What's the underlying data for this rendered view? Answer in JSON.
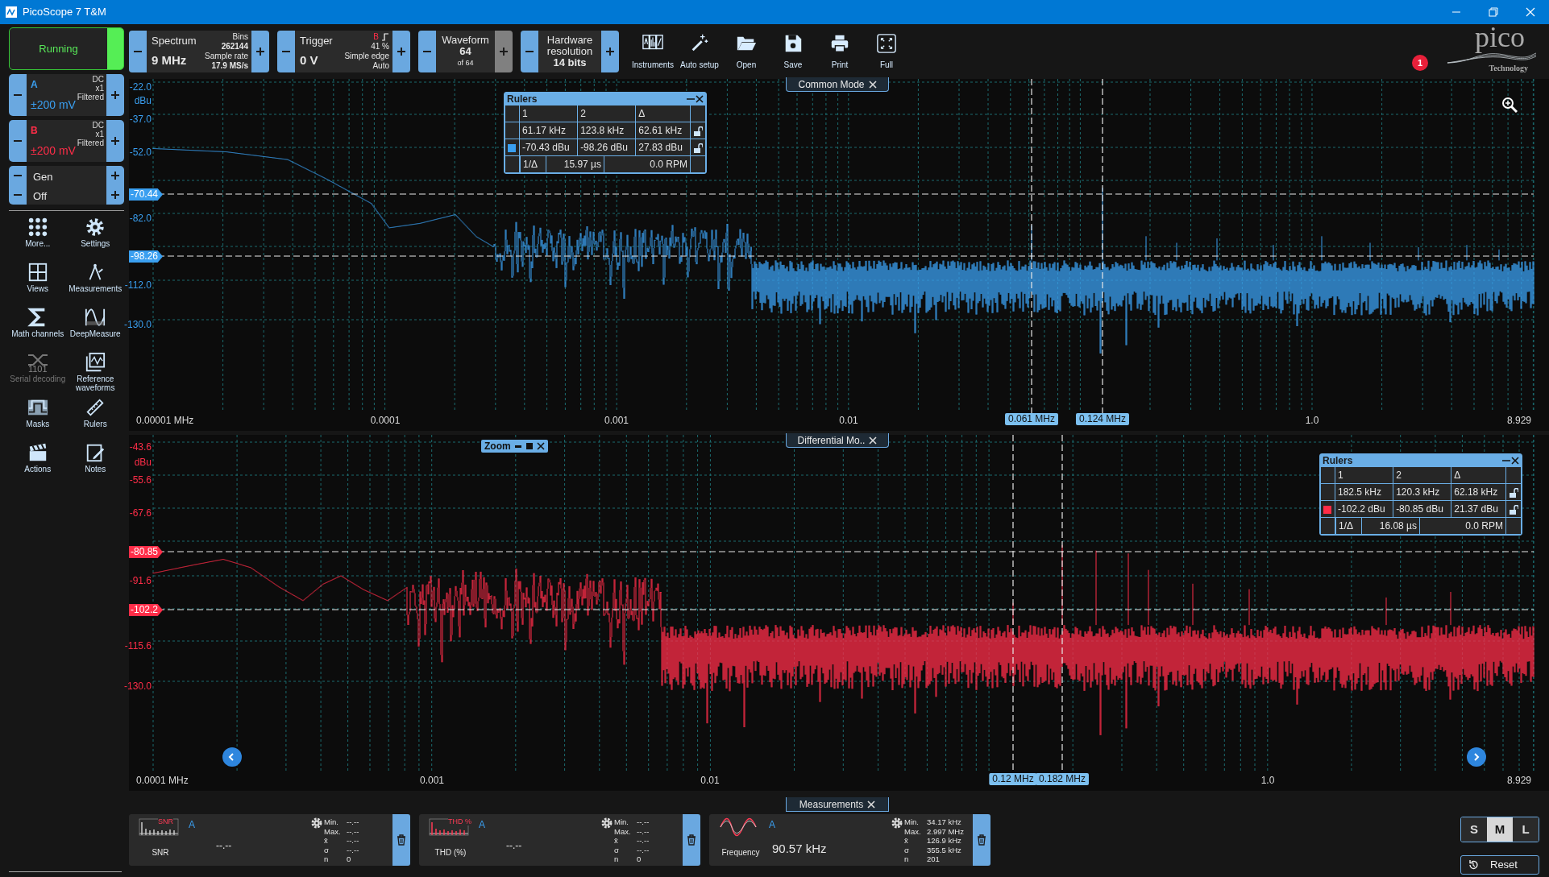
{
  "window": {
    "title": "PicoScope 7 T&M"
  },
  "run_button": {
    "label": "Running",
    "on": true
  },
  "controls": [
    {
      "kind": "spectrum",
      "title": "Spectrum",
      "value": "9 MHz",
      "details": [
        "Bins",
        "262144",
        "Sample rate",
        "17.9 MS/s"
      ],
      "plus_disabled": false
    },
    {
      "kind": "trigger",
      "title": "Trigger",
      "value": "0 V",
      "source": "B",
      "details": [
        "41 %",
        "Simple edge",
        "Auto"
      ],
      "plus_disabled": false
    },
    {
      "kind": "center",
      "title": "Waveform",
      "value": "64",
      "note": "of 64",
      "plus_disabled": true
    },
    {
      "kind": "center",
      "title": "Hardware resolution",
      "value": "14 bits",
      "plus_disabled": false
    }
  ],
  "tool_buttons": [
    "Instruments",
    "Auto setup",
    "Open",
    "Save",
    "Print",
    "Full"
  ],
  "notification_count": "1",
  "logo": {
    "name": "pico",
    "tagline": "Technology"
  },
  "channels": [
    {
      "name": "A",
      "range": "±200 mV",
      "details": [
        "DC",
        "x1",
        "Filtered"
      ],
      "color": "#3a9ff0"
    },
    {
      "name": "B",
      "range": "±200 mV",
      "details": [
        "DC",
        "x1",
        "Filtered"
      ],
      "color": "#ff2d48"
    }
  ],
  "generator": [
    "Gen",
    "Off"
  ],
  "tools": [
    {
      "label": "More...",
      "disabled": false
    },
    {
      "label": "Settings",
      "disabled": false
    },
    {
      "label": "Views",
      "disabled": false
    },
    {
      "label": "Measurements",
      "disabled": false
    },
    {
      "label": "Math channels",
      "disabled": false
    },
    {
      "label": "DeepMeasure",
      "disabled": false
    },
    {
      "label": "Serial decoding",
      "disabled": true,
      "icon_text": "1101"
    },
    {
      "label": "Reference waveforms",
      "disabled": false
    },
    {
      "label": "Masks",
      "disabled": false
    },
    {
      "label": "Rulers",
      "disabled": false
    },
    {
      "label": "Actions",
      "disabled": false
    },
    {
      "label": "Notes",
      "disabled": false
    }
  ],
  "views": [
    {
      "tab": "Common Mode",
      "color": "#3a9ff0",
      "y_axis": [
        {
          "kind": "tick",
          "text": "-22.0"
        },
        {
          "kind": "unit",
          "text": "dBu"
        },
        {
          "kind": "tick",
          "text": "-37.0"
        },
        {
          "kind": "tick",
          "text": "-52.0"
        },
        {
          "kind": "ruler",
          "text": "-70.44"
        },
        {
          "kind": "tick",
          "text": "-82.0"
        },
        {
          "kind": "ruler",
          "text": "-98.26"
        },
        {
          "kind": "tick",
          "text": "-112.0"
        },
        {
          "kind": "tick",
          "text": "-130.0"
        }
      ],
      "x_axis": [
        {
          "kind": "tick",
          "text": "0.00001 MHz"
        },
        {
          "kind": "tick",
          "text": "0.0001"
        },
        {
          "kind": "tick",
          "text": "0.001"
        },
        {
          "kind": "tick",
          "text": "0.01"
        },
        {
          "kind": "ruler",
          "text": "0.061 MHz"
        },
        {
          "kind": "ruler",
          "text": "0.124 MHz"
        },
        {
          "kind": "tick",
          "text": "1.0"
        },
        {
          "kind": "tick",
          "text": "8.929"
        }
      ],
      "rulers": {
        "title": "Rulers",
        "header": [
          "1",
          "2",
          "Δ"
        ],
        "rows": [
          [
            "61.17 kHz",
            "123.8 kHz",
            "62.61 kHz"
          ],
          [
            "-70.43 dBu",
            "-98.26 dBu",
            "27.83 dBu"
          ]
        ],
        "footer": [
          "1/Δ",
          "15.97 µs",
          "0.0 RPM"
        ]
      }
    },
    {
      "tab": "Differential Mo..",
      "color": "#ff2d48",
      "zoom_panel": "Zoom",
      "y_axis": [
        {
          "kind": "tick",
          "text": "-43.6"
        },
        {
          "kind": "unit",
          "text": "dBu"
        },
        {
          "kind": "tick",
          "text": "-55.6"
        },
        {
          "kind": "tick",
          "text": "-67.6"
        },
        {
          "kind": "ruler",
          "text": "-80.85"
        },
        {
          "kind": "tick",
          "text": "-91.6"
        },
        {
          "kind": "ruler",
          "text": "-102.2"
        },
        {
          "kind": "tick",
          "text": "-115.6"
        },
        {
          "kind": "tick",
          "text": "-130.0"
        }
      ],
      "x_axis": [
        {
          "kind": "tick",
          "text": "0.0001 MHz"
        },
        {
          "kind": "tick",
          "text": "0.001"
        },
        {
          "kind": "tick",
          "text": "0.01"
        },
        {
          "kind": "ruler",
          "text": "0.12 MHz"
        },
        {
          "kind": "ruler",
          "text": "0.182 MHz"
        },
        {
          "kind": "tick",
          "text": "1.0"
        },
        {
          "kind": "tick",
          "text": "8.929"
        }
      ],
      "rulers": {
        "title": "Rulers",
        "header": [
          "1",
          "2",
          "Δ"
        ],
        "rows": [
          [
            "182.5 kHz",
            "120.3 kHz",
            "62.18 kHz"
          ],
          [
            "-102.2 dBu",
            "-80.85 dBu",
            "21.37 dBu"
          ]
        ],
        "footer": [
          "1/Δ",
          "16.08 µs",
          "0.0 RPM"
        ]
      }
    }
  ],
  "measurements": {
    "tab": "Measurements",
    "cards": [
      {
        "kind": "spectrum",
        "icon_text": "SNR",
        "channel": "A",
        "name": "SNR",
        "value": "--.--",
        "stats": [
          {
            "label": "Min.",
            "value": "--.--"
          },
          {
            "label": "Max.",
            "value": "--.--"
          },
          {
            "label": "x̄",
            "value": "--.--"
          },
          {
            "label": "σ",
            "value": "--.--"
          },
          {
            "label": "n",
            "value": "0"
          }
        ]
      },
      {
        "kind": "spectrum",
        "icon_text": "THD %",
        "channel": "A",
        "name": "THD (%)",
        "value": "--.--",
        "stats": [
          {
            "label": "Min.",
            "value": "--.--"
          },
          {
            "label": "Max.",
            "value": "--.--"
          },
          {
            "label": "x̄",
            "value": "--.--"
          },
          {
            "label": "σ",
            "value": "--.--"
          },
          {
            "label": "n",
            "value": "0"
          }
        ]
      },
      {
        "kind": "wave",
        "channel": "A",
        "name": "Frequency",
        "value": "90.57 kHz",
        "stats": [
          {
            "label": "Min.",
            "value": "34.17 kHz"
          },
          {
            "label": "Max.",
            "value": "2.997 MHz"
          },
          {
            "label": "x̄",
            "value": "126.9 kHz"
          },
          {
            "label": "σ",
            "value": "355.5 kHz"
          },
          {
            "label": "n",
            "value": "201"
          }
        ]
      }
    ],
    "sizes": [
      {
        "label": "S",
        "selected": false
      },
      {
        "label": "M",
        "selected": true
      },
      {
        "label": "L",
        "selected": false
      }
    ],
    "reset": "Reset"
  }
}
